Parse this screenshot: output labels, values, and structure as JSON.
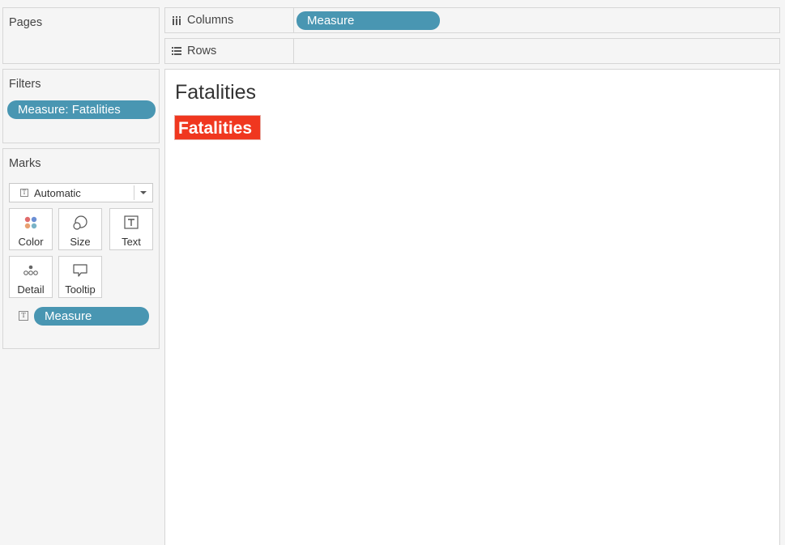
{
  "pages": {
    "title": "Pages"
  },
  "filters": {
    "title": "Filters",
    "pills": [
      "Measure: Fatalities"
    ]
  },
  "marks": {
    "title": "Marks",
    "mark_type": "Automatic",
    "buttons": {
      "color": "Color",
      "size": "Size",
      "text": "Text",
      "detail": "Detail",
      "tooltip": "Tooltip"
    },
    "text_pill": "Measure"
  },
  "columns": {
    "label": "Columns",
    "pill": "Measure"
  },
  "rows": {
    "label": "Rows"
  },
  "sheet": {
    "title": "Fatalities",
    "value_label": "Fatalities"
  },
  "colors": {
    "pill": "#4996b2",
    "highlight": "#f0371f"
  },
  "icons": [
    "columns-icon",
    "rows-icon",
    "text-type-icon",
    "color-icon",
    "size-icon",
    "text-icon",
    "detail-icon",
    "tooltip-icon"
  ]
}
